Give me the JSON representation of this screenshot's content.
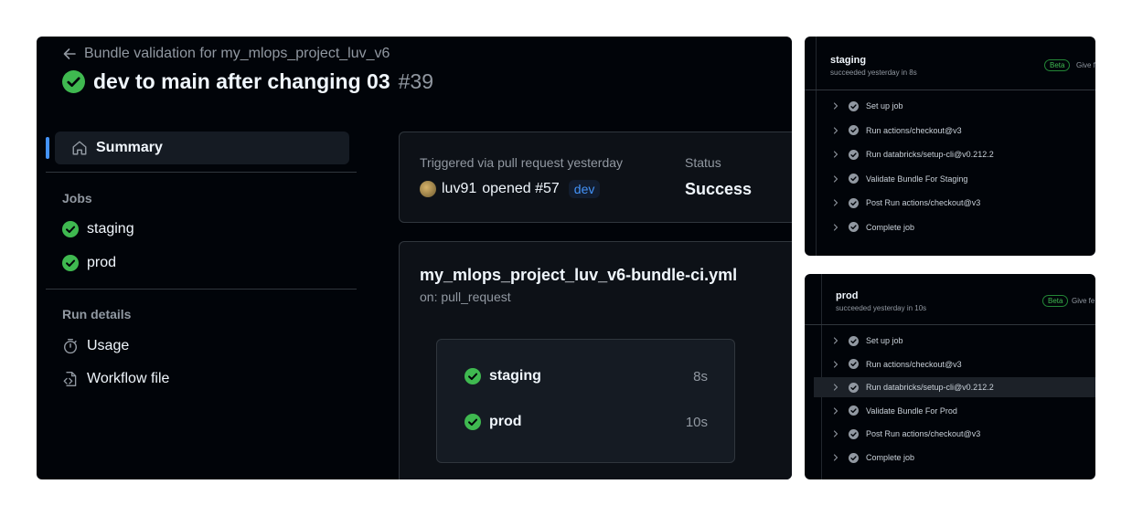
{
  "header": {
    "breadcrumb": "Bundle validation for my_mlops_project_luv_v6",
    "run_title": "dev to main after changing 03",
    "run_number": "#39"
  },
  "sidebar": {
    "summary": "Summary",
    "jobs_heading": "Jobs",
    "jobs": [
      {
        "label": "staging",
        "status": "success"
      },
      {
        "label": "prod",
        "status": "success"
      }
    ],
    "run_details_heading": "Run details",
    "usage": "Usage",
    "workflow_file": "Workflow file"
  },
  "trigger": {
    "label": "Triggered via pull request yesterday",
    "actor": "luv91",
    "action": "opened #57",
    "branch": "dev",
    "status_label": "Status",
    "status_value": "Success"
  },
  "workflow": {
    "file": "my_mlops_project_luv_v6-bundle-ci.yml",
    "on": "on: pull_request",
    "jobs": [
      {
        "name": "staging",
        "duration": "8s"
      },
      {
        "name": "prod",
        "duration": "10s"
      }
    ]
  },
  "staging_panel": {
    "title": "staging",
    "subtitle": "succeeded yesterday in 8s",
    "beta": "Beta",
    "give_feedback": "Give fe",
    "steps": [
      "Set up job",
      "Run actions/checkout@v3",
      "Run databricks/setup-cli@v0.212.2",
      "Validate Bundle For Staging",
      "Post Run actions/checkout@v3",
      "Complete job"
    ]
  },
  "prod_panel": {
    "title": "prod",
    "subtitle": "succeeded yesterday in 10s",
    "beta": "Beta",
    "give_feedback": "Give fe",
    "steps": [
      "Set up job",
      "Run actions/checkout@v3",
      "Run databricks/setup-cli@v0.212.2",
      "Validate Bundle For Prod",
      "Post Run actions/checkout@v3",
      "Complete job"
    ],
    "highlighted_step": "Run databricks/setup-cli@v0.212.2"
  },
  "colors": {
    "success": "#3fb950",
    "accent": "#4493f8",
    "background": "#010409"
  }
}
